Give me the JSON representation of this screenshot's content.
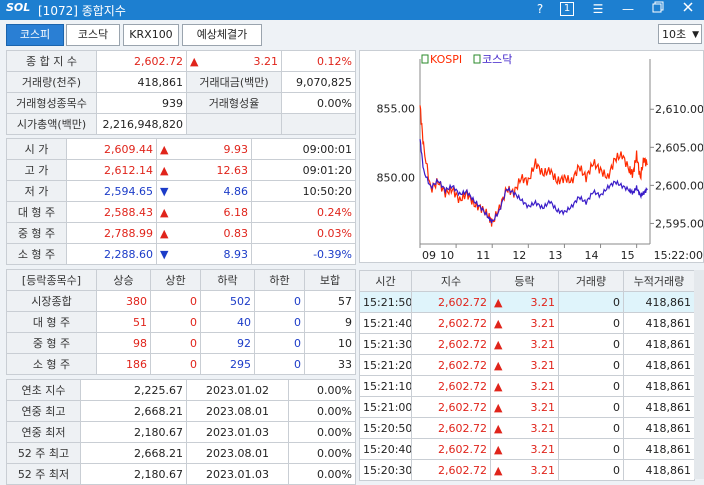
{
  "window": {
    "logo": "SOL",
    "title": "[1072] 종합지수",
    "help": "?",
    "one": "1",
    "menu": "☰",
    "min": "—"
  },
  "tabs": [
    "코스피",
    "코스닥",
    "KRX100",
    "예상체결가"
  ],
  "interval": "10초",
  "summary": {
    "index_label": "종 합 지 수",
    "index": "2,602.72",
    "change": "3.21",
    "rate": "0.12%",
    "vol_label": "거래량(천주)",
    "vol": "418,861",
    "amt_label": "거래대금(백만)",
    "amt": "9,070,825",
    "form_cnt_label": "거래형성종목수",
    "form_cnt": "939",
    "form_rate_label": "거래형성율",
    "form_rate": "0.00%",
    "mcap_label": "시가총액(백만)",
    "mcap": "2,216,948,820"
  },
  "prices": [
    {
      "label": "시    가",
      "value": "2,609.44",
      "dir": "up",
      "chg": "9.93",
      "extra": "09:00:01"
    },
    {
      "label": "고    가",
      "value": "2,612.14",
      "dir": "up",
      "chg": "12.63",
      "extra": "09:01:20"
    },
    {
      "label": "저    가",
      "value": "2,594.65",
      "dir": "down",
      "chg": "4.86",
      "extra": "10:50:20"
    },
    {
      "label": "대 형 주",
      "value": "2,588.43",
      "dir": "up",
      "chg": "6.18",
      "extra": "0.24%"
    },
    {
      "label": "중 형 주",
      "value": "2,788.99",
      "dir": "up",
      "chg": "0.83",
      "extra": "0.03%"
    },
    {
      "label": "소 형 주",
      "value": "2,288.60",
      "dir": "down",
      "chg": "8.93",
      "extra": "-0.39%"
    }
  ],
  "updown": {
    "headers": [
      "[등락종목수]",
      "상승",
      "상한",
      "하락",
      "하한",
      "보합"
    ],
    "rows": [
      {
        "label": "시장종합",
        "up": "380",
        "uplimit": "0",
        "down": "502",
        "downlimit": "0",
        "flat": "57"
      },
      {
        "label": "대 형 주",
        "up": "51",
        "uplimit": "0",
        "down": "40",
        "downlimit": "0",
        "flat": "9"
      },
      {
        "label": "중 형 주",
        "up": "98",
        "uplimit": "0",
        "down": "92",
        "downlimit": "0",
        "flat": "10"
      },
      {
        "label": "소 형 주",
        "up": "186",
        "uplimit": "0",
        "down": "295",
        "downlimit": "0",
        "flat": "33"
      }
    ]
  },
  "yearly": [
    {
      "label": "연초  지수",
      "value": "2,225.67",
      "date": "2023.01.02",
      "rate": "0.00%"
    },
    {
      "label": "연중  최고",
      "value": "2,668.21",
      "date": "2023.08.01",
      "rate": "0.00%"
    },
    {
      "label": "연중  최저",
      "value": "2,180.67",
      "date": "2023.01.03",
      "rate": "0.00%"
    },
    {
      "label": "52 주 최고",
      "value": "2,668.21",
      "date": "2023.08.01",
      "rate": "0.00%"
    },
    {
      "label": "52 주 최저",
      "value": "2,180.67",
      "date": "2023.01.03",
      "rate": "0.00%"
    }
  ],
  "ticks": {
    "headers": [
      "시간",
      "지수",
      "등락",
      "거래량",
      "누적거래량"
    ],
    "rows": [
      {
        "time": "15:21:50",
        "index": "2,602.72",
        "chg": "3.21",
        "vol": "0",
        "cum": "418,861"
      },
      {
        "time": "15:21:40",
        "index": "2,602.72",
        "chg": "3.21",
        "vol": "0",
        "cum": "418,861"
      },
      {
        "time": "15:21:30",
        "index": "2,602.72",
        "chg": "3.21",
        "vol": "0",
        "cum": "418,861"
      },
      {
        "time": "15:21:20",
        "index": "2,602.72",
        "chg": "3.21",
        "vol": "0",
        "cum": "418,861"
      },
      {
        "time": "15:21:10",
        "index": "2,602.72",
        "chg": "3.21",
        "vol": "0",
        "cum": "418,861"
      },
      {
        "time": "15:21:00",
        "index": "2,602.72",
        "chg": "3.21",
        "vol": "0",
        "cum": "418,861"
      },
      {
        "time": "15:20:50",
        "index": "2,602.72",
        "chg": "3.21",
        "vol": "0",
        "cum": "418,861"
      },
      {
        "time": "15:20:40",
        "index": "2,602.72",
        "chg": "3.21",
        "vol": "0",
        "cum": "418,861"
      },
      {
        "time": "15:20:30",
        "index": "2,602.72",
        "chg": "3.21",
        "vol": "0",
        "cum": "418,861"
      }
    ]
  },
  "chart_data": {
    "type": "line",
    "legend": [
      "KOSPI",
      "코스닥"
    ],
    "series_colors": [
      "#ff2a00",
      "#3a1cc8"
    ],
    "left_axis": {
      "ticks": [
        "855.00",
        "850.00"
      ],
      "values": [
        855,
        850
      ],
      "range": [
        845.2,
        858.6
      ]
    },
    "right_axis": {
      "ticks": [
        "2,610.00",
        "2,605.00",
        "2,600.00",
        "2,595.00"
      ],
      "values": [
        2610,
        2605,
        2600,
        2595
      ],
      "range": [
        2592.3,
        2616.6
      ]
    },
    "x_ticks": [
      "09",
      "10",
      "11",
      "12",
      "13",
      "14",
      "15"
    ],
    "x_hours": [
      9,
      10,
      11,
      12,
      13,
      14,
      15
    ],
    "x_end_label": "15:22:00",
    "x_range": [
      9,
      15.37
    ],
    "kospi": {
      "x": [
        9.0,
        9.1,
        9.3,
        9.5,
        9.7,
        9.9,
        10.1,
        10.3,
        10.5,
        10.7,
        10.9,
        11.0,
        11.2,
        11.4,
        11.6,
        11.8,
        12.0,
        12.2,
        12.4,
        12.6,
        12.8,
        13.0,
        13.2,
        13.4,
        13.6,
        13.8,
        14.0,
        14.2,
        14.4,
        14.6,
        14.8,
        14.9,
        15.0,
        15.1,
        15.2,
        15.3
      ],
      "y": [
        2610.5,
        2605,
        2599.5,
        2600.5,
        2599,
        2599.5,
        2598,
        2599,
        2597.5,
        2597,
        2596,
        2595,
        2597,
        2599.5,
        2599,
        2601,
        2600.5,
        2603,
        2601.5,
        2602,
        2600.5,
        2601,
        2600.5,
        2602.5,
        2601,
        2603,
        2602,
        2601,
        2603.5,
        2604,
        2602,
        2601.5,
        2604,
        2601,
        2603.5,
        2602.7
      ]
    },
    "kosdaq": {
      "x": [
        9.0,
        9.1,
        9.3,
        9.5,
        9.7,
        9.9,
        10.1,
        10.3,
        10.5,
        10.7,
        10.9,
        11.0,
        11.2,
        11.4,
        11.6,
        11.8,
        12.0,
        12.2,
        12.4,
        12.6,
        12.8,
        13.0,
        13.2,
        13.4,
        13.6,
        13.8,
        14.0,
        14.2,
        14.4,
        14.6,
        14.8,
        14.9,
        15.0,
        15.1,
        15.2,
        15.3
      ],
      "y": [
        852.8,
        850.5,
        849.3,
        849.8,
        849.1,
        849.4,
        848.8,
        849.0,
        848.3,
        847.8,
        847.1,
        846.8,
        847.6,
        849.2,
        848.9,
        848.4,
        847.9,
        848.2,
        847.8,
        848.3,
        847.6,
        847.5,
        847.9,
        848.6,
        848.2,
        849.0,
        848.7,
        849.3,
        849.7,
        849.4,
        849.1,
        848.9,
        849.3,
        848.7,
        848.9,
        849.2
      ]
    }
  }
}
